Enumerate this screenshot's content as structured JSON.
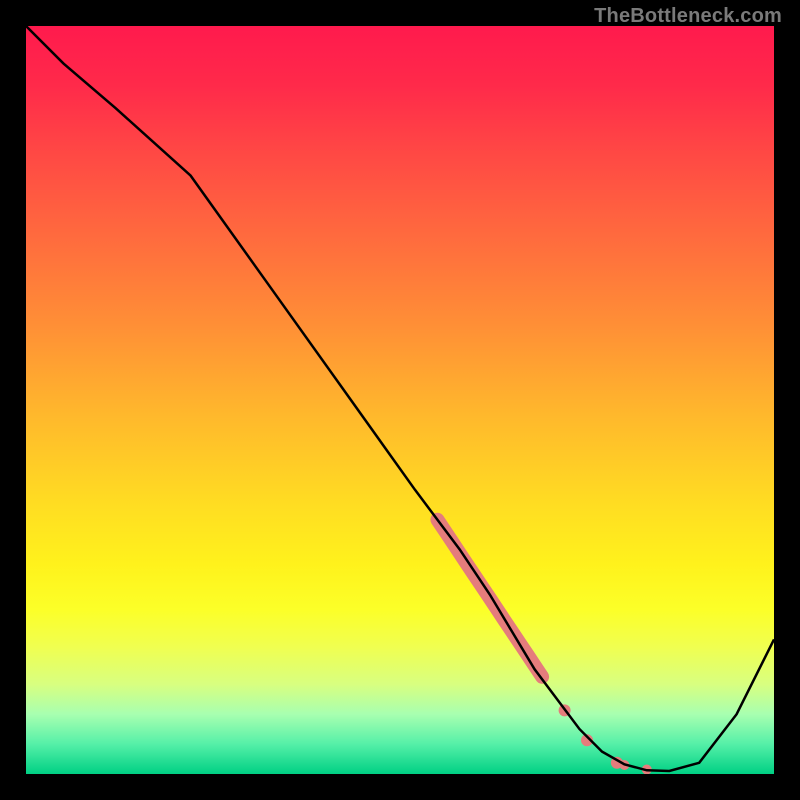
{
  "watermark_text": "TheBottleneck.com",
  "colors": {
    "frame": "#000000",
    "curve": "#000000",
    "scatter": "#e57c7c"
  },
  "chart_data": {
    "type": "line",
    "title": "",
    "xlabel": "",
    "ylabel": "",
    "xlim": [
      0,
      100
    ],
    "ylim": [
      0,
      100
    ],
    "series": [
      {
        "name": "bottleneck-curve",
        "x": [
          0,
          5,
          12,
          22,
          32,
          42,
          52,
          58,
          62,
          65,
          68,
          71,
          74,
          77,
          80,
          83,
          86,
          90,
          95,
          100
        ],
        "y": [
          100,
          95,
          89,
          80,
          66,
          52,
          38,
          30,
          24,
          19,
          14,
          10,
          6,
          3,
          1.3,
          0.5,
          0.4,
          1.5,
          8,
          18
        ]
      }
    ],
    "scatter_band": {
      "name": "highlighted-region",
      "points": [
        {
          "x": 55,
          "y": 34
        },
        {
          "x": 56,
          "y": 32.5
        },
        {
          "x": 57,
          "y": 31
        },
        {
          "x": 58,
          "y": 29.5
        },
        {
          "x": 59,
          "y": 28
        },
        {
          "x": 60,
          "y": 26.5
        },
        {
          "x": 61,
          "y": 25
        },
        {
          "x": 62,
          "y": 23.5
        },
        {
          "x": 63,
          "y": 22
        },
        {
          "x": 64,
          "y": 20.5
        },
        {
          "x": 65,
          "y": 19
        },
        {
          "x": 66,
          "y": 17.5
        },
        {
          "x": 67,
          "y": 16
        },
        {
          "x": 68,
          "y": 14.5
        },
        {
          "x": 69,
          "y": 13
        },
        {
          "x": 72,
          "y": 8.5
        },
        {
          "x": 75,
          "y": 4.5
        },
        {
          "x": 79,
          "y": 1.5
        },
        {
          "x": 80,
          "y": 1.2
        },
        {
          "x": 83,
          "y": 0.6
        }
      ]
    }
  }
}
